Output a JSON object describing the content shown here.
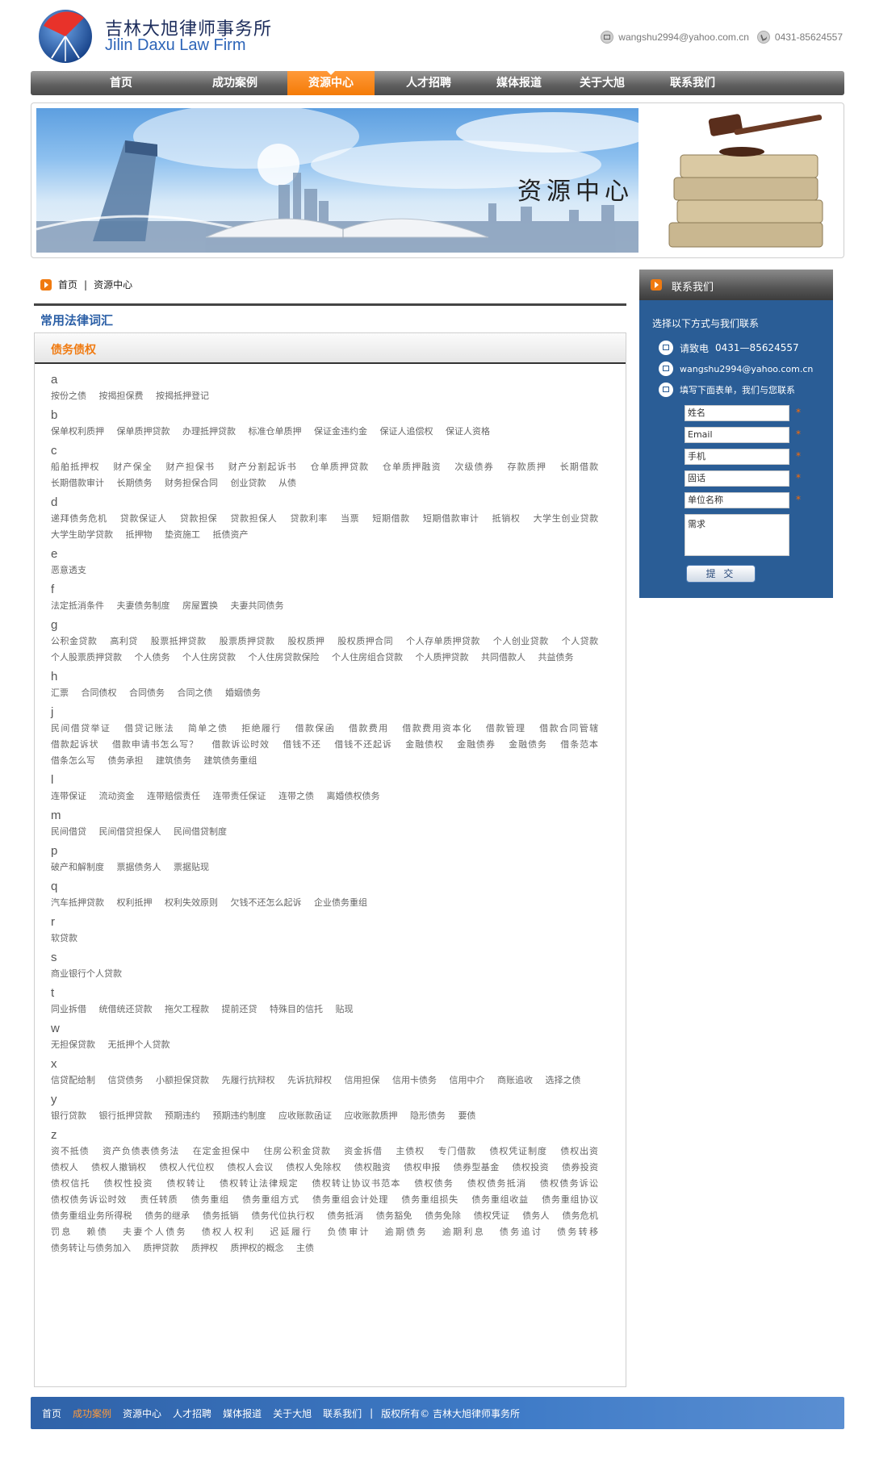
{
  "header": {
    "firm_name_cn": "吉林大旭律师事务所",
    "firm_name_en": "Jilin Daxu Law Firm",
    "email": "wangshu2994@yahoo.com.cn",
    "phone": "0431-85624557"
  },
  "nav": {
    "items": [
      "首页",
      "成功案例",
      "资源中心",
      "人才招聘",
      "媒体报道",
      "关于大旭",
      "联系我们"
    ],
    "active": "资源中心"
  },
  "banner": {
    "title": "资源中心"
  },
  "breadcrumb": {
    "home": "首页",
    "sep": "|",
    "current": "资源中心"
  },
  "section": {
    "title": "常用法律词汇",
    "panel_title": "债务债权"
  },
  "glossary": [
    {
      "letter": "a",
      "terms": [
        "按份之债",
        "按揭担保费",
        "按揭抵押登记"
      ]
    },
    {
      "letter": "b",
      "terms": [
        "保单权利质押",
        "保单质押贷款",
        "办理抵押贷款",
        "标准仓单质押",
        "保证金违约金",
        "保证人追偿权",
        "保证人资格"
      ]
    },
    {
      "letter": "c",
      "terms": [
        "船舶抵押权",
        "财产保全",
        "财产担保书",
        "财产分割起诉书",
        "仓单质押贷款",
        "仓单质押融资",
        "次级债券",
        "存款质押",
        "长期借款",
        "长期借款审计",
        "长期债务",
        "财务担保合同",
        "创业贷款",
        "从债"
      ]
    },
    {
      "letter": "d",
      "terms": [
        "递拜债务危机",
        "贷款保证人",
        "贷款担保",
        "贷款担保人",
        "贷款利率",
        "当票",
        "短期借款",
        "短期借款审计",
        "抵销权",
        "大学生创业贷款",
        "大学生助学贷款",
        "抵押物",
        "垫资施工",
        "抵债资产"
      ]
    },
    {
      "letter": "e",
      "terms": [
        "恶意透支"
      ]
    },
    {
      "letter": "f",
      "terms": [
        "法定抵消条件",
        "夫妻债务制度",
        "房屋置换",
        "夫妻共同债务"
      ]
    },
    {
      "letter": "g",
      "terms": [
        "公积金贷款",
        "高利贷",
        "股票抵押贷款",
        "股票质押贷款",
        "股权质押",
        "股权质押合同",
        "个人存单质押贷款",
        "个人创业贷款",
        "个人贷款",
        "个人股票质押贷款",
        "个人债务",
        "个人住房贷款",
        "个人住房贷款保险",
        "个人住房组合贷款",
        "个人质押贷款",
        "共同借款人",
        "共益债务"
      ]
    },
    {
      "letter": "h",
      "terms": [
        "汇票",
        "合同债权",
        "合同债务",
        "合同之债",
        "婚姻债务"
      ]
    },
    {
      "letter": "j",
      "terms": [
        "民间借贷举证",
        "借贷记账法",
        "简单之债",
        "拒绝履行",
        "借款保函",
        "借款费用",
        "借款费用资本化",
        "借款管理",
        "借款合同管辖",
        "借款起诉状",
        "借款申请书怎么写？",
        "借款诉讼时效",
        "借钱不还",
        "借钱不还起诉",
        "金融债权",
        "金融债券",
        "金融债务",
        "借条范本",
        "借条怎么写",
        "债务承担",
        "建筑债务",
        "建筑债务重组"
      ]
    },
    {
      "letter": "l",
      "terms": [
        "连带保证",
        "流动资金",
        "连带赔偿责任",
        "连带责任保证",
        "连带之债",
        "离婚债权债务"
      ]
    },
    {
      "letter": "m",
      "terms": [
        "民间借贷",
        "民间借贷担保人",
        "民间借贷制度"
      ]
    },
    {
      "letter": "p",
      "terms": [
        "破产和解制度",
        "票据债务人",
        "票据贴现"
      ]
    },
    {
      "letter": "q",
      "terms": [
        "汽车抵押贷款",
        "权利抵押",
        "权利失效原则",
        "欠钱不还怎么起诉",
        "企业债务重组"
      ]
    },
    {
      "letter": "r",
      "terms": [
        "软贷款"
      ]
    },
    {
      "letter": "s",
      "terms": [
        "商业银行个人贷款"
      ]
    },
    {
      "letter": "t",
      "terms": [
        "同业拆借",
        "统借统还贷款",
        "拖欠工程款",
        "提前还贷",
        "特殊目的信托",
        "贴现"
      ]
    },
    {
      "letter": "w",
      "terms": [
        "无担保贷款",
        "无抵押个人贷款"
      ]
    },
    {
      "letter": "x",
      "terms": [
        "信贷配给制",
        "信贷债务",
        "小额担保贷款",
        "先履行抗辩权",
        "先诉抗辩权",
        "信用担保",
        "信用卡债务",
        "信用中介",
        "商账追收",
        "选择之债"
      ]
    },
    {
      "letter": "y",
      "terms": [
        "银行贷款",
        "银行抵押贷款",
        "预期违约",
        "预期违约制度",
        "应收账款函证",
        "应收账款质押",
        "隐形债务",
        "要债"
      ]
    },
    {
      "letter": "z",
      "terms": [
        "资不抵债",
        "资产负债表债务法",
        "在定金担保中",
        "住房公积金贷款",
        "资金拆借",
        "主债权",
        "专门借款",
        "债权凭证制度",
        "债权出资",
        "债权人",
        "债权人撤销权",
        "债权人代位权",
        "债权人会议",
        "债权人免除权",
        "债权融资",
        "债权申报",
        "债券型基金",
        "债权投资",
        "债券投资",
        "债权信托",
        "债权性投资",
        "债权转让",
        "债权转让法律规定",
        "债权转让协议书范本",
        "债权债务",
        "债权债务抵消",
        "债权债务诉讼",
        "债权债务诉讼时效",
        "责任转质",
        "债务重组",
        "债务重组方式",
        "债务重组会计处理",
        "债务重组损失",
        "债务重组收益",
        "债务重组协议",
        "债务重组业务所得税",
        "债务的继承",
        "债务抵销",
        "债务代位执行权",
        "债务抵消",
        "债务豁免",
        "债务免除",
        "债权凭证",
        "债务人",
        "债务危机",
        "罚息",
        "赖债",
        "夫妻个人债务",
        "债权人权利",
        "迟延履行",
        "负债审计",
        "逾期债务",
        "逾期利息",
        "债务追讨",
        "债务转移",
        "债务转让与债务加入",
        "质押贷款",
        "质押权",
        "质押权的概念",
        "主债"
      ]
    }
  ],
  "sidebar": {
    "title": "联系我们",
    "intro": "选择以下方式与我们联系",
    "call_label": "请致电",
    "phone": "0431—85624557",
    "email": "wangshu2994@yahoo.com.cn",
    "form_hint": "填写下面表单，我们与您联系",
    "fields": [
      "姓名",
      "Email",
      "手机",
      "固话",
      "单位名称"
    ],
    "textarea": "需求",
    "required_mark": "*",
    "submit": "提 交"
  },
  "footer": {
    "links": [
      "首页",
      "成功案例",
      "资源中心",
      "人才招聘",
      "媒体报道",
      "关于大旭",
      "联系我们"
    ],
    "active": "成功案例",
    "sep": "|",
    "copyright": "版权所有© 吉林大旭律师事务所"
  }
}
